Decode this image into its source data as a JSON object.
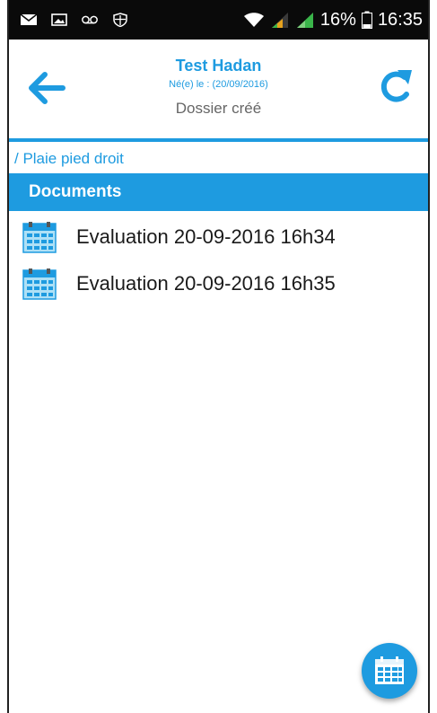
{
  "status_bar": {
    "battery": "16%",
    "time": "16:35",
    "icons_left": [
      "mail-icon",
      "image-icon",
      "voicemail-icon",
      "shield-icon"
    ],
    "icons_right": [
      "wifi-icon",
      "signal-icon",
      "signal-icon",
      "battery-icon"
    ]
  },
  "header": {
    "patient_name": "Test Hadan",
    "birth_date": "Né(e) le : (20/09/2016)",
    "status": "Dossier créé"
  },
  "breadcrumb": "/ Plaie pied droit",
  "section": {
    "title": "Documents"
  },
  "documents": [
    {
      "label": "Evaluation 20-09-2016 16h34"
    },
    {
      "label": "Evaluation 20-09-2016 16h35"
    }
  ],
  "colors": {
    "accent": "#1e9be0",
    "status_bar": "#0a0a0a"
  }
}
